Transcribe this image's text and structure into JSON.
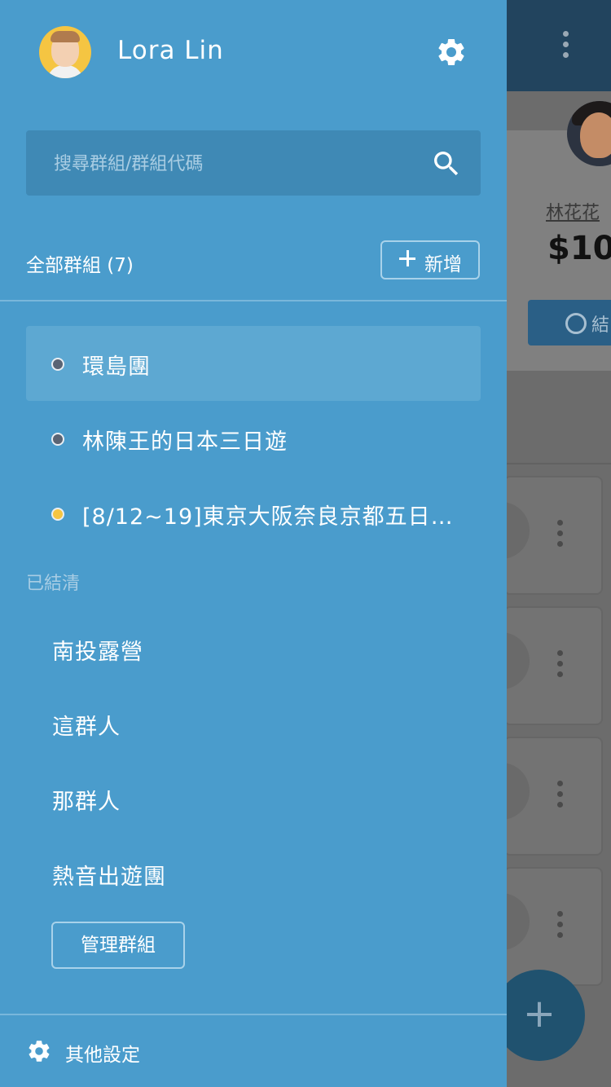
{
  "background": {
    "member_name": "林花花",
    "amount": "$10",
    "settle_label": "結",
    "fab_icon": "+"
  },
  "drawer": {
    "user": {
      "name": "Lora Lin"
    },
    "search": {
      "placeholder": "搜尋群組/群組代碼"
    },
    "groups_header": "全部群組 (7)",
    "add_label": "新增",
    "active_groups": [
      {
        "label": "環島團",
        "dot_color": "#5a6474",
        "selected": true
      },
      {
        "label": "林陳王的日本三日遊",
        "dot_color": "#5a6474",
        "selected": false
      },
      {
        "label": "[8/12~19]東京大阪奈良京都五日…",
        "dot_color": "#f5c542",
        "selected": false
      }
    ],
    "settled_header": "已結清",
    "settled_groups": [
      {
        "label": "南投露營"
      },
      {
        "label": "這群人"
      },
      {
        "label": "那群人"
      },
      {
        "label": "熱音出遊團"
      }
    ],
    "manage_label": "管理群組",
    "other_settings_label": "其他設定"
  },
  "colors": {
    "drawer_bg": "#4a9ccc",
    "search_bg": "#3f89b5",
    "active_item_bg": "#5da8d2",
    "topbar": "#22445e"
  }
}
